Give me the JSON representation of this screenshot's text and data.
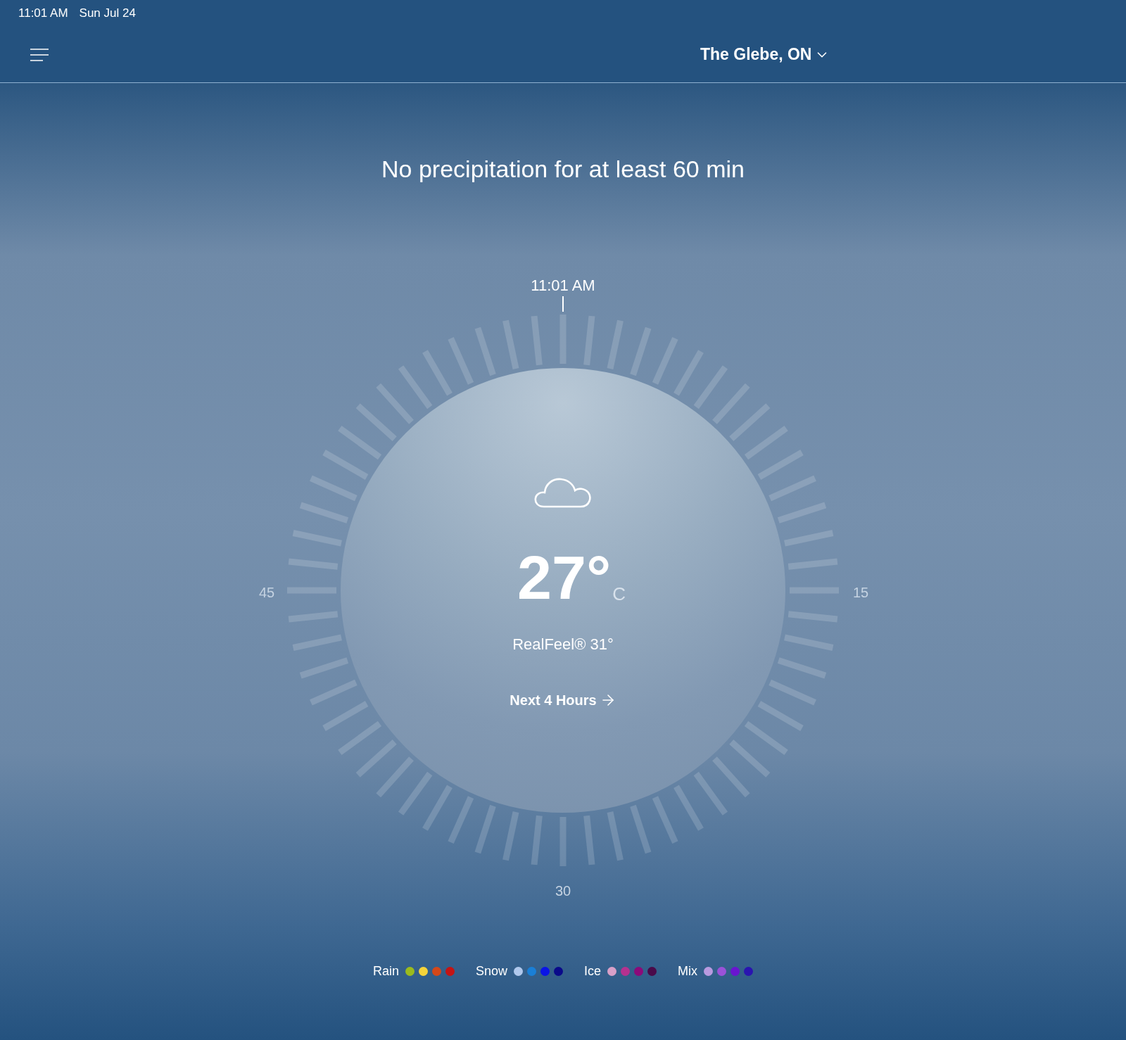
{
  "status_bar": {
    "time": "11:01 AM",
    "date": "Sun Jul 24"
  },
  "header": {
    "location": "The Glebe, ON"
  },
  "summary": "No precipitation for at least 60 min",
  "dial": {
    "time_label": "11:01 AM",
    "minute_labels": [
      "45",
      "15",
      "30"
    ]
  },
  "current": {
    "temperature": "27°",
    "unit": "C",
    "realfeel": "RealFeel® 31°",
    "link": "Next 4 Hours"
  },
  "legend": [
    {
      "label": "Rain",
      "dots": [
        {
          "color": "#9bbb1d"
        },
        {
          "color": "#f5d33a"
        },
        {
          "color": "#d4481a"
        },
        {
          "color": "#c41414"
        }
      ]
    },
    {
      "label": "Snow",
      "dots": [
        {
          "color": "#b0c8ec"
        },
        {
          "color": "#1a7fd6"
        },
        {
          "color": "#0a14e6"
        },
        {
          "color": "#0a0a8a"
        }
      ]
    },
    {
      "label": "Ice",
      "dots": [
        {
          "color": "#d8a0c8"
        },
        {
          "color": "#b5318f"
        },
        {
          "color": "#8c0a7a"
        },
        {
          "color": "#4a0a4a"
        }
      ]
    },
    {
      "label": "Mix",
      "dots": [
        {
          "color": "#b99ae0"
        },
        {
          "color": "#9a52d8"
        },
        {
          "color": "#6a14d0"
        },
        {
          "color": "#2a14b0"
        }
      ]
    }
  ]
}
